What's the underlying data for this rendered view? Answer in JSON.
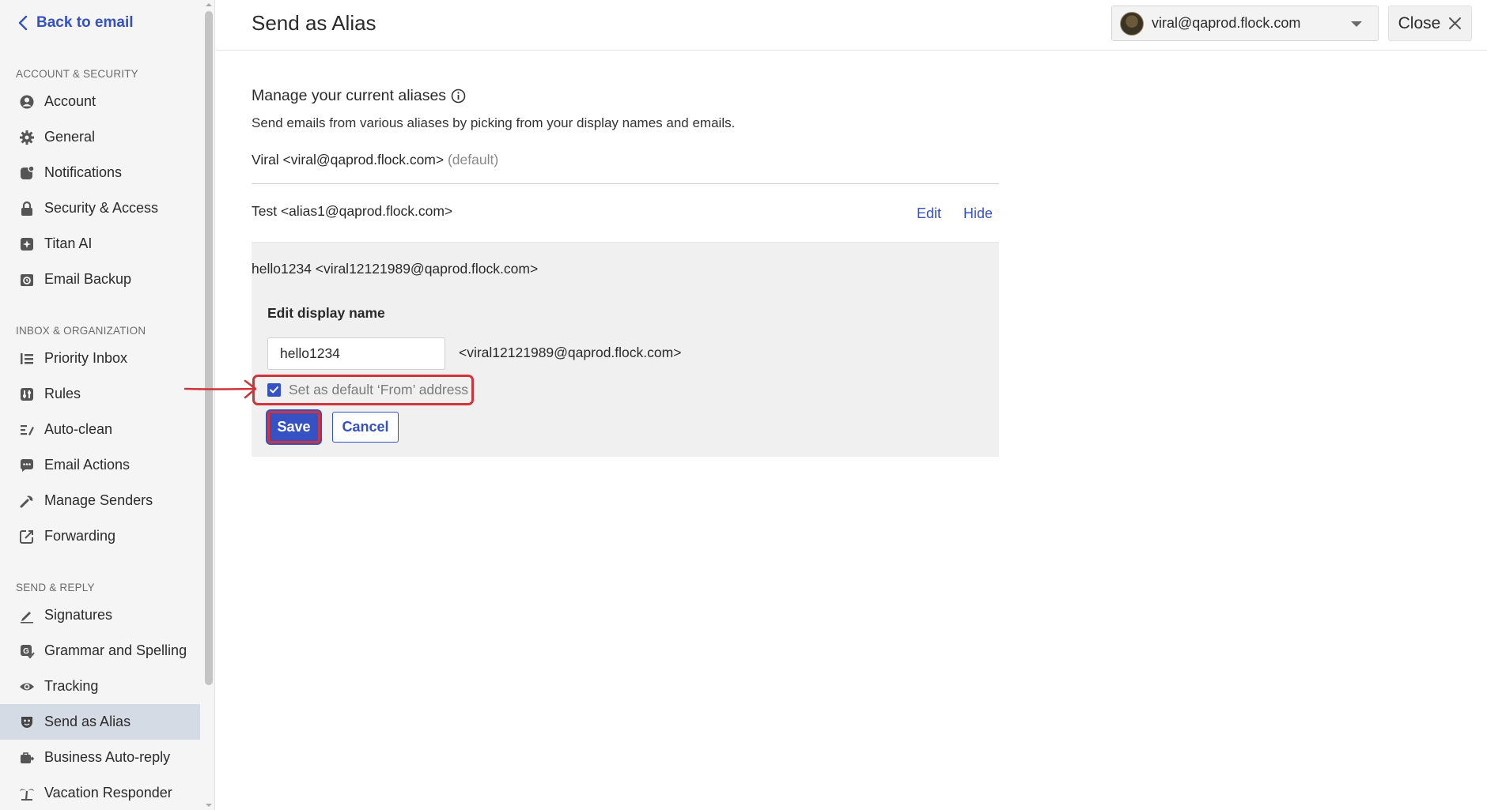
{
  "sidebar": {
    "back_label": "Back to email",
    "sections": [
      {
        "label": "ACCOUNT & SECURITY"
      },
      {
        "label": "INBOX & ORGANIZATION"
      },
      {
        "label": "SEND & REPLY"
      }
    ],
    "items": [
      {
        "label": "Account",
        "icon": "user-circle-icon"
      },
      {
        "label": "General",
        "icon": "gear-icon"
      },
      {
        "label": "Notifications",
        "icon": "notification-icon"
      },
      {
        "label": "Security & Access",
        "icon": "lock-icon"
      },
      {
        "label": "Titan AI",
        "icon": "sparkle-icon"
      },
      {
        "label": "Email Backup",
        "icon": "backup-icon"
      },
      {
        "label": "Priority Inbox",
        "icon": "priority-list-icon"
      },
      {
        "label": "Rules",
        "icon": "rules-icon"
      },
      {
        "label": "Auto-clean",
        "icon": "auto-clean-icon"
      },
      {
        "label": "Email Actions",
        "icon": "email-actions-icon"
      },
      {
        "label": "Manage Senders",
        "icon": "wrench-icon"
      },
      {
        "label": "Forwarding",
        "icon": "forward-icon"
      },
      {
        "label": "Signatures",
        "icon": "pen-icon"
      },
      {
        "label": "Grammar and Spelling",
        "icon": "grammar-icon"
      },
      {
        "label": "Tracking",
        "icon": "eye-icon"
      },
      {
        "label": "Send as Alias",
        "icon": "alias-mask-icon",
        "active": true
      },
      {
        "label": "Business Auto-reply",
        "icon": "business-reply-icon"
      },
      {
        "label": "Vacation Responder",
        "icon": "palm-tree-icon"
      }
    ]
  },
  "header": {
    "title": "Send as Alias",
    "account_email": "viral@qaprod.flock.com",
    "close_label": "Close"
  },
  "main": {
    "manage_title": "Manage your current aliases",
    "manage_desc": "Send emails from various aliases by picking from your display names and emails.",
    "default_alias": "Viral <viral@qaprod.flock.com>",
    "default_tag": "(default)",
    "alias_test": "Test <alias1@qaprod.flock.com>",
    "edit_link": "Edit",
    "hide_link": "Hide",
    "edit_panel": {
      "alias": "hello1234 <viral12121989@qaprod.flock.com>",
      "label": "Edit display name",
      "display_name_value": "hello1234",
      "email": "<viral12121989@qaprod.flock.com>",
      "checkbox_label": "Set as default ‘From’ address",
      "checkbox_checked": true,
      "save_label": "Save",
      "cancel_label": "Cancel"
    }
  },
  "colors": {
    "accent": "#3551c4",
    "highlight": "#d0333a",
    "sidebar_active": "#d5dbe4"
  }
}
